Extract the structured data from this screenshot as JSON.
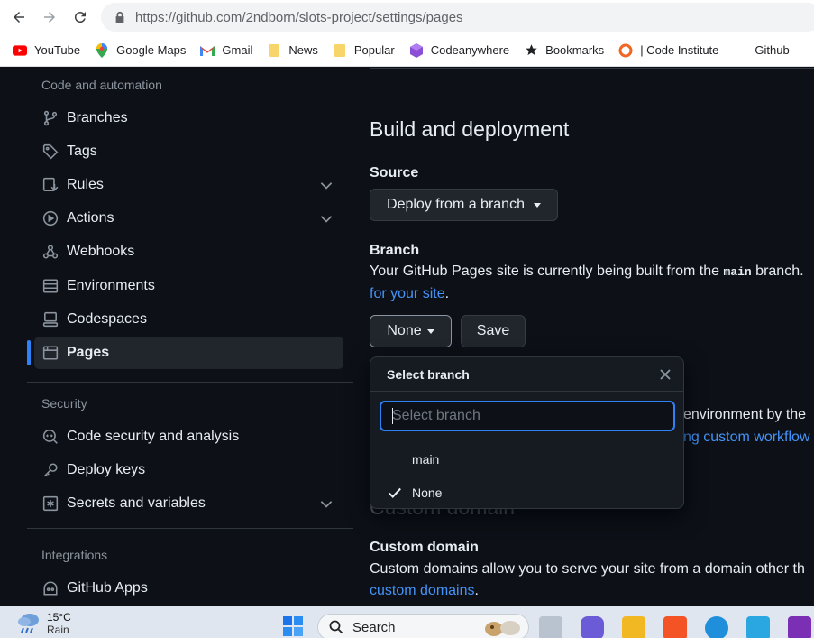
{
  "browser": {
    "url": "https://github.com/2ndborn/slots-project/settings/pages",
    "bookmarks": [
      {
        "label": "YouTube",
        "icon": "youtube-icon"
      },
      {
        "label": "Google Maps",
        "icon": "maps-pin-icon"
      },
      {
        "label": "Gmail",
        "icon": "gmail-icon"
      },
      {
        "label": "News",
        "icon": "folder-icon"
      },
      {
        "label": "Popular",
        "icon": "folder-icon"
      },
      {
        "label": "Codeanywhere",
        "icon": "codeanywhere-icon"
      },
      {
        "label": "Bookmarks",
        "icon": "star-icon"
      },
      {
        "label": "| Code Institute",
        "icon": "code-institute-icon"
      },
      {
        "label": "Github",
        "icon": ""
      }
    ]
  },
  "sidebar": {
    "sections": {
      "code_automation": "Code and automation",
      "security": "Security",
      "integrations": "Integrations"
    },
    "items": [
      {
        "label": "Branches",
        "icon": "git-branch-icon"
      },
      {
        "label": "Tags",
        "icon": "tag-icon"
      },
      {
        "label": "Rules",
        "icon": "rules-icon"
      },
      {
        "label": "Actions",
        "icon": "play-icon"
      },
      {
        "label": "Webhooks",
        "icon": "webhook-icon"
      },
      {
        "label": "Environments",
        "icon": "server-icon"
      },
      {
        "label": "Codespaces",
        "icon": "codespaces-icon"
      },
      {
        "label": "Pages",
        "icon": "browser-icon"
      },
      {
        "label": "Code security and analysis",
        "icon": "codescan-icon"
      },
      {
        "label": "Deploy keys",
        "icon": "key-icon"
      },
      {
        "label": "Secrets and variables",
        "icon": "asterisk-icon"
      },
      {
        "label": "GitHub Apps",
        "icon": "apps-icon"
      }
    ]
  },
  "main": {
    "heading": "Build and deployment",
    "source_label": "Source",
    "source_button": "Deploy from a branch",
    "branch_label": "Branch",
    "branch_text_pre": "Your GitHub Pages site is currently being built from the ",
    "branch_code": "main",
    "branch_text_post": " branch.",
    "branch_link": "for your site",
    "branch_link_after": ".",
    "none_button": "None",
    "save_button": "Save",
    "hidden_text": "environment by the",
    "hidden_link": "ng custom workflow",
    "hidden_heading": "Custom domain",
    "custom_domain_label": "Custom domain",
    "custom_domain_text": "Custom domains allow you to serve your site from a domain other th",
    "custom_domain_link": "custom domains",
    "custom_domain_after": "."
  },
  "dropdown": {
    "title": "Select branch",
    "placeholder": "Select branch",
    "options": [
      {
        "label": "main",
        "selected": false
      },
      {
        "label": "None",
        "selected": true
      }
    ]
  },
  "taskbar": {
    "temperature": "15°C",
    "condition": "Rain",
    "search_label": "Search"
  },
  "colors": {
    "accent": "#2f81f7",
    "link": "#4493f8",
    "background": "#0d1117"
  }
}
